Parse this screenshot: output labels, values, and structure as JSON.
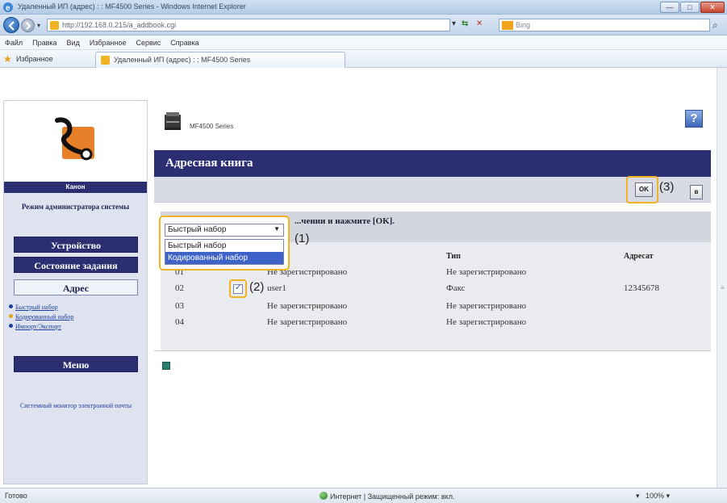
{
  "browser": {
    "title": "Удаленный ИП (адрес) : : MF4500 Series - Windows Internet Explorer",
    "url": "http://192.168.0.215/a_addbook.cgi",
    "search_placeholder": "Bing",
    "menu": [
      "Файл",
      "Правка",
      "Вид",
      "Избранное",
      "Сервис",
      "Справка"
    ],
    "favorites_label": "Избранное",
    "tab_title": "Удаленный ИП (адрес) : : MF4500 Series",
    "status_text": "Готово",
    "status_zone": "Интернет | Защищенный режим: вкл.",
    "zoom": "100%"
  },
  "sidebar": {
    "logo_caption": "Канон",
    "admin_mode": "Режим администратора системы",
    "device_label": "Устройство",
    "jobs_label": "Состояние задания",
    "address_label": "Адрес",
    "links": [
      "Быстрый набор",
      "Кодированный набор",
      "Импорт/Экспорт"
    ],
    "menu_label": "Меню",
    "remote_link": "Системный монитор электронной почты"
  },
  "main": {
    "printer_name": "MF4500 Series",
    "title": "Адресная книга",
    "ok_label": "OK",
    "cancel_label": "в",
    "instruction": "...чении и нажмите [OK].",
    "dropdown": {
      "selected": "Быстрый набор",
      "options": [
        "Быстрый набор",
        "Кодированный набор"
      ]
    },
    "columns": {
      "type": "Тип",
      "address": "Адресат"
    },
    "rows": [
      {
        "num": "01",
        "name": "Не зарегистрировано",
        "type": "Не зарегистрировано",
        "address": ""
      },
      {
        "num": "02",
        "name": "user1",
        "type": "Факс",
        "address": "12345678"
      },
      {
        "num": "03",
        "name": "Не зарегистрировано",
        "type": "Не зарегистрировано",
        "address": ""
      },
      {
        "num": "04",
        "name": "Не зарегистрировано",
        "type": "Не зарегистрировано",
        "address": ""
      }
    ],
    "callouts": {
      "step1": "(1)",
      "step2": "(2)",
      "step3": "(3)"
    }
  },
  "colors": {
    "accent_navy": "#2b2f72",
    "highlight": "#f0b323",
    "selected_option": "#3d63c9"
  }
}
